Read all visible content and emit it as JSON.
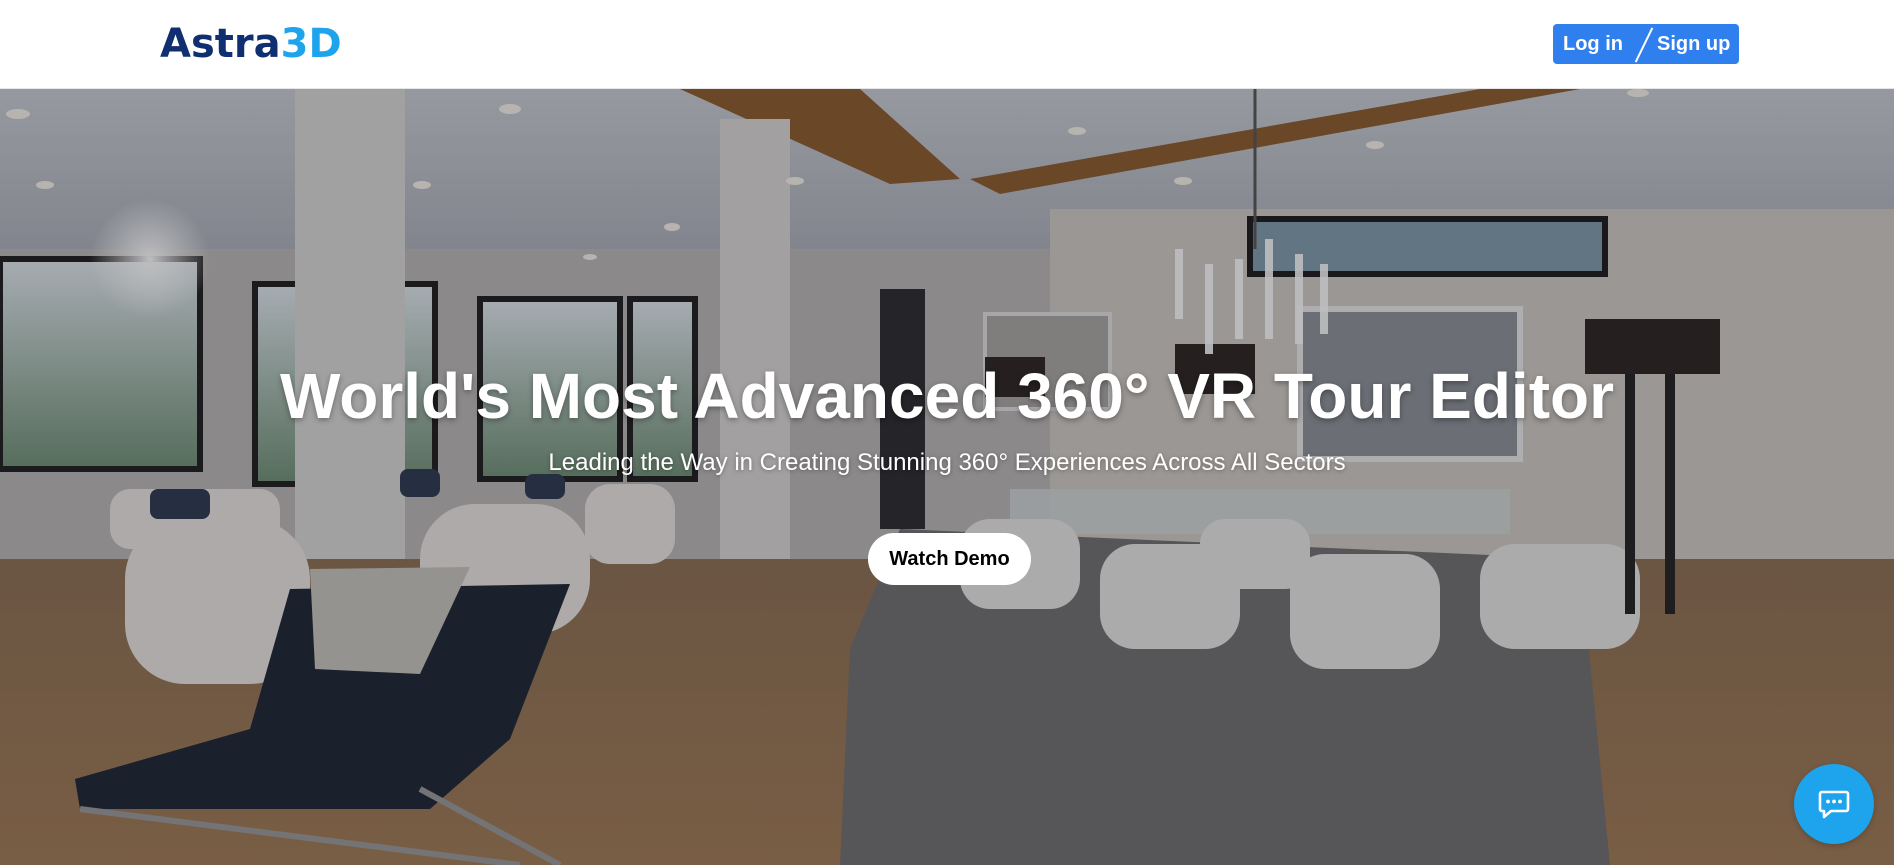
{
  "brand": {
    "logo_part1": "Astra",
    "logo_part2": "3D",
    "primary_color": "#0f2f70",
    "accent_color": "#1ea4ec"
  },
  "header": {
    "login_label": "Log in",
    "signup_label": "Sign up",
    "auth_bg_color": "#2f7fef"
  },
  "hero": {
    "title": "World's Most Advanced 360° VR Tour Editor",
    "subtitle": "Leading the Way in Creating Stunning 360° Experiences Across All Sectors",
    "cta_label": "Watch Demo",
    "background_image": "interior-living-dining-room-photo"
  },
  "chat": {
    "icon": "chat-bubble-icon"
  }
}
